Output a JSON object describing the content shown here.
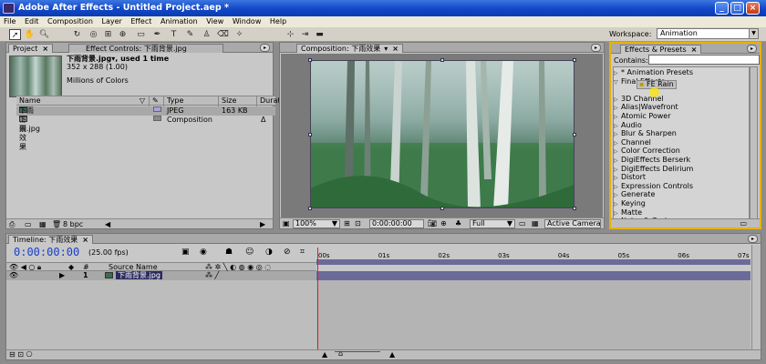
{
  "window": {
    "title": "Adobe After Effects - Untitled Project.aep *",
    "min": "_",
    "max": "□",
    "close": "×"
  },
  "menu": [
    "File",
    "Edit",
    "Composition",
    "Layer",
    "Effect",
    "Animation",
    "View",
    "Window",
    "Help"
  ],
  "workspace": {
    "label": "Workspace:",
    "value": "Animation"
  },
  "project": {
    "tabs": [
      "Project",
      "Effect Controls: 下雨背景.jpg"
    ],
    "selected_name": "下雨背景.jpg",
    "selected_used": ", used 1 time",
    "dimensions": "352 x 288 (1.00)",
    "colors": "Millions of Colors",
    "columns": [
      "Name",
      "Type",
      "Size",
      "Durat"
    ],
    "items": [
      {
        "name": "下雨背景.jpg",
        "type": "JPEG",
        "size": "163 KB",
        "dur": ""
      },
      {
        "name": "下雨效果",
        "type": "Composition",
        "size": "",
        "dur": "Δ"
      }
    ],
    "bpc": "8 bpc"
  },
  "composition": {
    "tab": "Composition: 下雨效果",
    "zoom": "100%",
    "timecode": "0:00:00:00",
    "resolution": "Full",
    "camera": "Active Camera"
  },
  "effects": {
    "tab": "Effects & Presets",
    "contains_label": "Contains:",
    "items": [
      {
        "label": "* Animation Presets",
        "open": false
      },
      {
        "label": "Final Effects",
        "open": true
      },
      {
        "label": "3D Channel",
        "open": false
      },
      {
        "label": "Alias|Wavefront",
        "open": false
      },
      {
        "label": "Atomic Power",
        "open": false
      },
      {
        "label": "Audio",
        "open": false
      },
      {
        "label": "Blur & Sharpen",
        "open": false
      },
      {
        "label": "Channel",
        "open": false
      },
      {
        "label": "Color Correction",
        "open": false
      },
      {
        "label": "DigiEffects Berserk",
        "open": false
      },
      {
        "label": "DigiEffects Delirium",
        "open": false
      },
      {
        "label": "Distort",
        "open": false
      },
      {
        "label": "Expression Controls",
        "open": false
      },
      {
        "label": "Generate",
        "open": false
      },
      {
        "label": "Keying",
        "open": false
      },
      {
        "label": "Matte",
        "open": false
      },
      {
        "label": "Noise & Grain",
        "open": false
      }
    ],
    "selected_effect": "FE Rain"
  },
  "timeline": {
    "tab": "Timeline: 下雨效果",
    "time": "0:00:00:00",
    "fps": "(25.00 fps)",
    "ticks": [
      "00s",
      "01s",
      "02s",
      "03s",
      "04s",
      "05s",
      "06s",
      "07s"
    ],
    "columns": {
      "num": "#",
      "source": "Source Name"
    },
    "layer": {
      "num": "1",
      "name": "下雨背景.jpg"
    }
  },
  "colors": {
    "accent": "#e8b100",
    "playhead": "#e02020",
    "track": "#6b6b9a",
    "titlebar": "#1146c8"
  }
}
